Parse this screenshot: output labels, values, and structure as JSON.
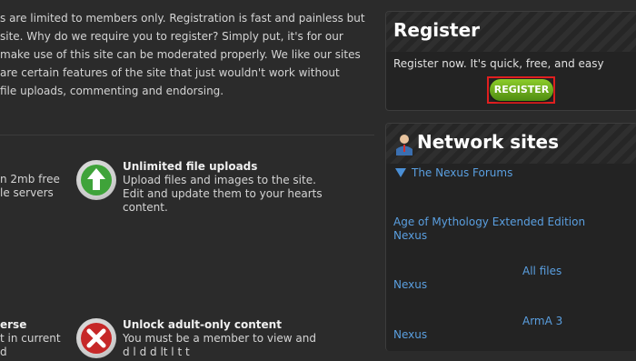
{
  "intro": {
    "lines": [
      "s are limited to members only. Registration is fast and painless but",
      "site. Why do we require you to register? Simply put, it's for our",
      "make use of this site can be moderated properly. We like our sites",
      "are certain features of the site that just wouldn't work without",
      "file uploads, commenting and endorsing."
    ]
  },
  "features": {
    "left_top": [
      "n 2mb free",
      "le servers"
    ],
    "uploads": {
      "title": "Unlimited file uploads",
      "lines": [
        "Upload files and images to the site.",
        "Edit and update them to your hearts",
        "content."
      ]
    },
    "left_bottom": [
      "erse",
      "t in current",
      "d"
    ],
    "adult": {
      "title": "Unlock adult-only content",
      "lines": [
        "You must be a member to view and",
        "d    l  d  d lt  l       t  t"
      ]
    }
  },
  "register": {
    "title": "Register",
    "text": "Register now. It's quick, free, and easy",
    "button_label": "REGISTER"
  },
  "network": {
    "title": "Network sites",
    "forums_link": "The Nexus Forums",
    "items": [
      {
        "name": "Age of Mythology Extended Edition",
        "sub": "Nexus"
      },
      {
        "name": "All files",
        "sub": "Nexus"
      },
      {
        "name": "ArmA 3",
        "sub": "Nexus"
      }
    ]
  },
  "colors": {
    "background": "#2b2b2b",
    "link": "#5a9fe0",
    "button_green": "#6aab1f",
    "highlight_red": "#e01f1f",
    "upload_icon_green": "#3fa33a",
    "adult_icon_red": "#c62828"
  },
  "icons": [
    "upload-arrow-icon",
    "cross-icon",
    "user-icon",
    "chevron-down-icon"
  ]
}
